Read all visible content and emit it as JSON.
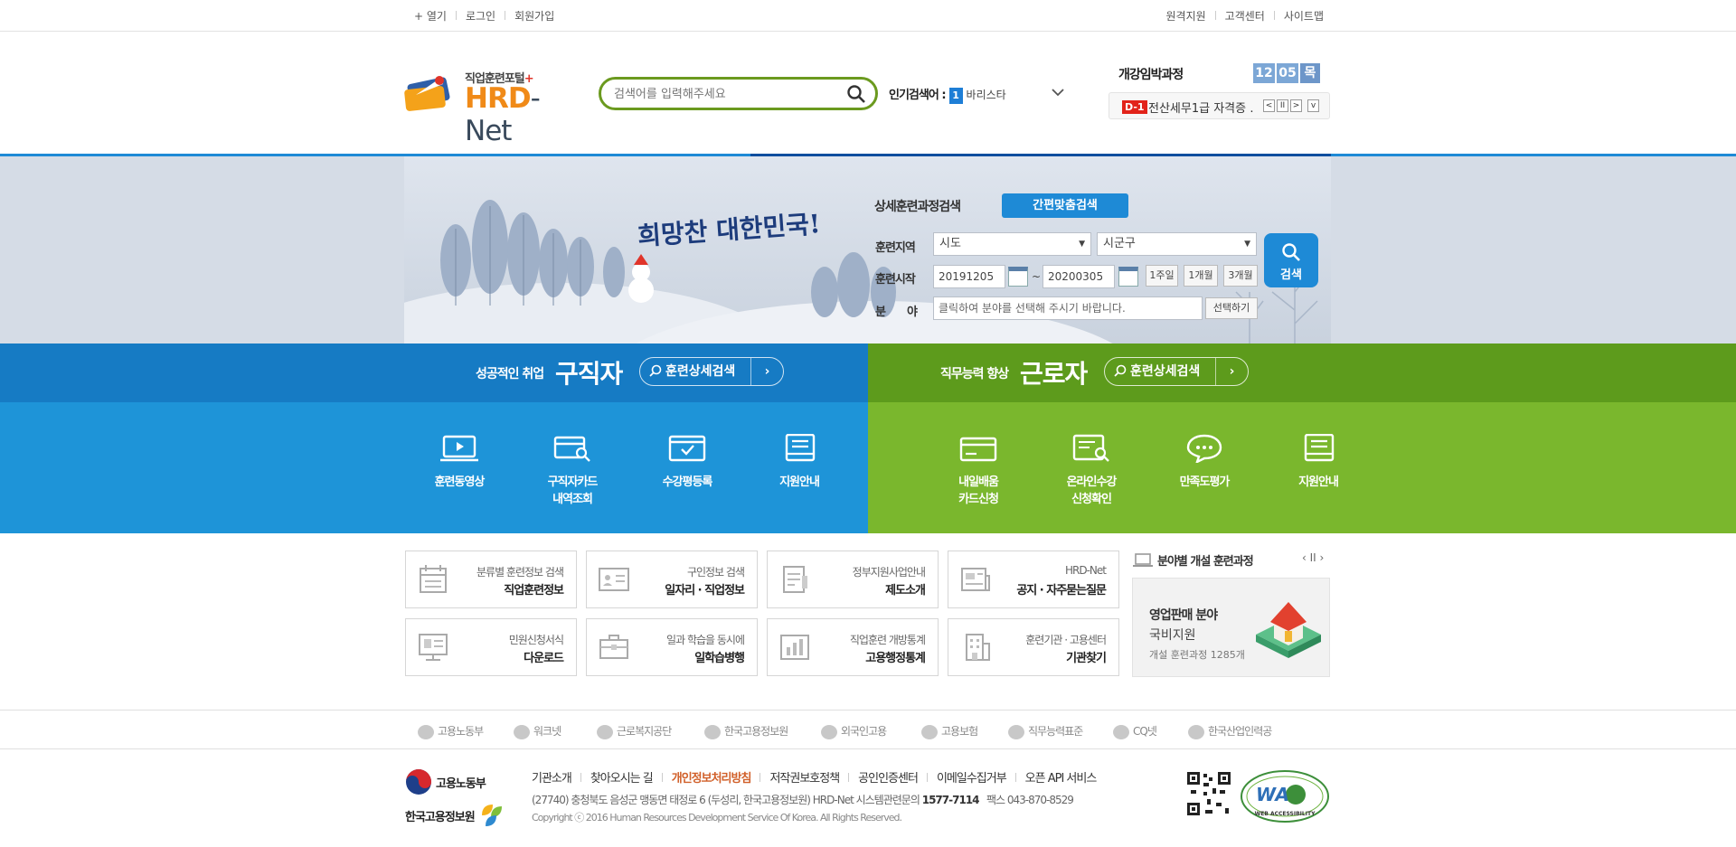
{
  "topbar": {
    "left": [
      "+ 열기",
      "로그인",
      "회원가입"
    ],
    "right": [
      "원격지원",
      "고객센터",
      "사이트맵"
    ]
  },
  "logo": {
    "sub": "직업훈련포털",
    "plus": "+",
    "main_a": "HRD",
    "main_b": "-Net"
  },
  "search": {
    "placeholder": "검색어를 입력해주세요"
  },
  "popular": {
    "label": "인기검색어 :",
    "rank": "1",
    "keyword": "바리스타"
  },
  "upcoming": {
    "title": "개강임박과정",
    "date": [
      "12",
      "05",
      "목"
    ],
    "dday": "D-1",
    "course": "전산세무1급 자격증 …",
    "controls": [
      "<",
      "II",
      ">",
      "v"
    ]
  },
  "banner": {
    "slogan": "희망찬 대한민국!",
    "adv_title": "상세훈련과정검색",
    "quick_btn": "간편맞춤검색",
    "region_label": "훈련지역",
    "region_sido": "시도",
    "region_sigungu": "시군구",
    "start_label": "훈련시작",
    "date_from": "20191205",
    "date_tilde": "~",
    "date_to": "20200305",
    "periods": [
      "1주일",
      "1개월",
      "3개월"
    ],
    "field_label": "분　　야",
    "field_placeholder": "클릭하여 분야를 선택해 주시기 바랍니다.",
    "field_select": "선택하기",
    "search_btn": "검색"
  },
  "jobseeker": {
    "sub": "성공적인 취업",
    "main": "구직자",
    "btn": "훈련상세검색",
    "items": [
      {
        "l1": "훈련동영상",
        "l2": ""
      },
      {
        "l1": "구직자카드",
        "l2": "내역조회"
      },
      {
        "l1": "수강평등록",
        "l2": ""
      },
      {
        "l1": "지원안내",
        "l2": ""
      }
    ]
  },
  "worker": {
    "sub": "직무능력 향상",
    "main": "근로자",
    "btn": "훈련상세검색",
    "items": [
      {
        "l1": "내일배움",
        "l2": "카드신청"
      },
      {
        "l1": "온라인수강",
        "l2": "신청확인"
      },
      {
        "l1": "만족도평가",
        "l2": ""
      },
      {
        "l1": "지원안내",
        "l2": ""
      }
    ]
  },
  "links": [
    {
      "s": "분류별 훈련정보 검색",
      "m": "직업훈련정보"
    },
    {
      "s": "구인정보 검색",
      "m": "일자리 · 직업정보"
    },
    {
      "s": "정부지원사업안내",
      "m": "제도소개"
    },
    {
      "s": "HRD-Net",
      "m": "공지 · 자주묻는질문"
    },
    {
      "s": "민원신청서식",
      "m": "다운로드"
    },
    {
      "s": "일과 학습을 동시에",
      "m": "일학습병행"
    },
    {
      "s": "직업훈련 개방통계",
      "m": "고용행정통계"
    },
    {
      "s": "훈련기관 · 고용센터",
      "m": "기관찾기"
    }
  ],
  "field_courses": {
    "title": "분야별 개설 훈련과정",
    "controls": "‹ II ›",
    "card_a": "영업판매 분야",
    "card_b": "국비지원",
    "card_c": "개설 훈련과정 1285개"
  },
  "partners": [
    "고용노동부",
    "워크넷",
    "근로복지공단",
    "한국고용정보원",
    "외국인고용",
    "고용보험",
    "직무능력표준",
    "CQ넷",
    "한국산업인력공"
  ],
  "footer": {
    "moel": "고용노동부",
    "keis": "한국고용정보원",
    "links": [
      "기관소개",
      "찾아오시는 길",
      "개인정보처리방침",
      "저작권보호정책",
      "공인인증센터",
      "이메일수집거부",
      "오픈 API 서비스"
    ],
    "addr": "(27740) 충청북도 음성군 맹동면 태정로 6 (두성리, 한국고용정보원) HRD-Net 시스템관련문의",
    "phone": "1577-7114",
    "fax": "팩스 043-870-8529",
    "copyright": "Copyright ⓒ 2016 Human Resources Development Service Of Korea. All Rights Reserved.",
    "wa_text": "WA",
    "wa_sub": "WEB ACCESSIBILITY"
  },
  "colors": {
    "blue": "#1e94d8",
    "darkblue": "#167bc4",
    "green": "#7ab72d",
    "darkgreen": "#5d9b1c",
    "orange": "#f08a18"
  }
}
